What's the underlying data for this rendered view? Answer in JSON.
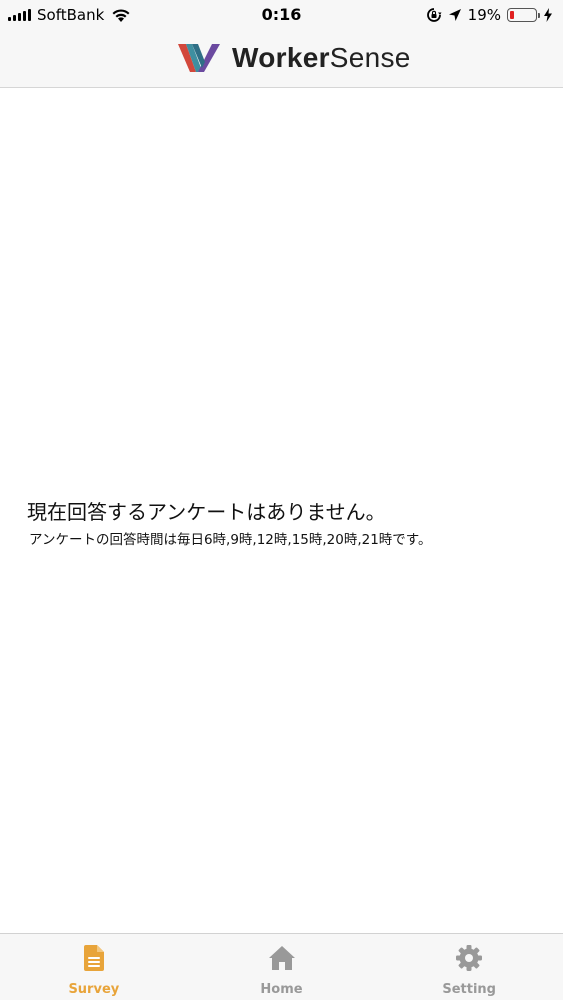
{
  "status_bar": {
    "carrier": "SoftBank",
    "time": "0:16",
    "battery_percent": "19%",
    "battery_level": 0.19,
    "icons": [
      "signal-icon",
      "wifi-icon",
      "orientation-lock-icon",
      "location-icon",
      "battery-icon",
      "charging-icon"
    ]
  },
  "header": {
    "logo_text_bold": "Worker",
    "logo_text_light": "Sense"
  },
  "main": {
    "empty_title": "現在回答するアンケートはありません。",
    "empty_subtitle": "アンケートの回答時間は毎日6時,9時,12時,15時,20時,21時です。"
  },
  "tabs": [
    {
      "label": "Survey",
      "icon": "document-icon",
      "active": true
    },
    {
      "label": "Home",
      "icon": "home-icon",
      "active": false
    },
    {
      "label": "Setting",
      "icon": "gear-icon",
      "active": false
    }
  ],
  "colors": {
    "accent": "#e8a43a",
    "inactive": "#999999",
    "bar_background": "#f7f7f7",
    "logo_red": "#d2483c",
    "logo_teal": "#3f8fa0",
    "logo_purple": "#6b4aa0"
  }
}
